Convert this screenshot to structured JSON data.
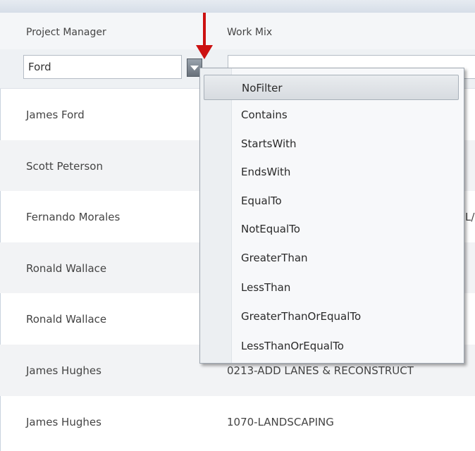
{
  "header": {
    "col1": "Project Manager",
    "col2": "Work Mix"
  },
  "filter": {
    "value": "Ford",
    "placeholder": ""
  },
  "rows": [
    {
      "pm": "James Ford",
      "wm": ""
    },
    {
      "pm": "Scott Peterson",
      "wm": ""
    },
    {
      "pm": "Fernando Morales",
      "wm": "L/"
    },
    {
      "pm": "Ronald Wallace",
      "wm": ""
    },
    {
      "pm": "Ronald Wallace",
      "wm": ""
    },
    {
      "pm": "James Hughes",
      "wm": "0213-ADD LANES & RECONSTRUCT"
    },
    {
      "pm": "James Hughes",
      "wm": "1070-LANDSCAPING"
    }
  ],
  "menu": {
    "selected": "NoFilter",
    "items": [
      "NoFilter",
      "Contains",
      "StartsWith",
      "EndsWith",
      "EqualTo",
      "NotEqualTo",
      "GreaterThan",
      "LessThan",
      "GreaterThanOrEqualTo",
      "LessThanOrEqualTo"
    ]
  },
  "colors": {
    "arrow": "#cc1111",
    "menu_bg": "#f7f8fa"
  },
  "icons": {
    "filter_button": "dropdown-triangle-icon",
    "annotation": "down-arrow-icon"
  }
}
